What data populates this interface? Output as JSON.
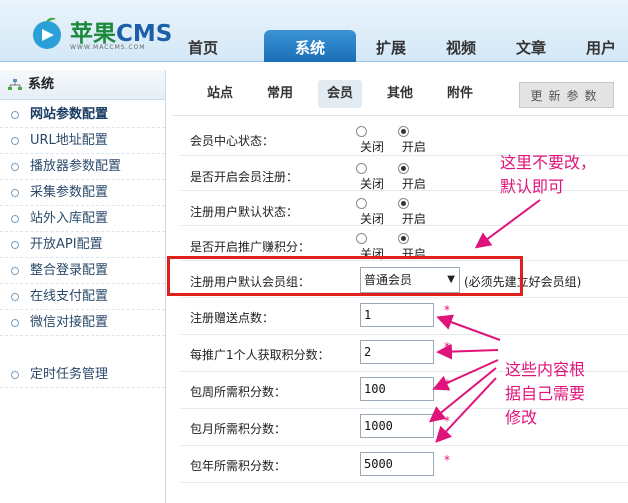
{
  "logo": {
    "brand_main": "苹果",
    "brand_cms": "CMS",
    "site": "WWW.MACCMS.COM"
  },
  "nav": [
    {
      "label": "首页",
      "active": false
    },
    {
      "label": "系统",
      "active": true
    },
    {
      "label": "扩展",
      "active": false
    },
    {
      "label": "视频",
      "active": false
    },
    {
      "label": "文章",
      "active": false
    },
    {
      "label": "用户",
      "active": false
    }
  ],
  "sidebar": {
    "title": "系统",
    "items": [
      {
        "label": "网站参数配置",
        "active": true
      },
      {
        "label": "URL地址配置"
      },
      {
        "label": "播放器参数配置"
      },
      {
        "label": "采集参数配置"
      },
      {
        "label": "站外入库配置"
      },
      {
        "label": "开放API配置"
      },
      {
        "label": "整合登录配置"
      },
      {
        "label": "在线支付配置"
      },
      {
        "label": "微信对接配置"
      },
      {
        "label": "定时任务管理"
      }
    ]
  },
  "tabs": [
    {
      "label": "站点"
    },
    {
      "label": "常用"
    },
    {
      "label": "会员",
      "active": true
    },
    {
      "label": "其他"
    },
    {
      "label": "附件"
    }
  ],
  "update_button": "更新参数",
  "radio_labels": {
    "off": "关闭",
    "on": "开启"
  },
  "rows": {
    "member_center": {
      "label": "会员中心状态：",
      "value": "on"
    },
    "open_register": {
      "label": "是否开启会员注册：",
      "value": "on"
    },
    "register_status": {
      "label": "注册用户默认状态：",
      "value": "on"
    },
    "promo_points": {
      "label": "是否开启推广赚积分：",
      "value": "on"
    },
    "default_group": {
      "label": "注册用户默认会员组：",
      "selected": "普通会员",
      "hint": "(必须先建立好会员组)"
    },
    "reg_points": {
      "label": "注册赠送点数：",
      "value": "1"
    },
    "promo_each": {
      "label": "每推广1个人获取积分数：",
      "value": "2"
    },
    "weekly": {
      "label": "包周所需积分数：",
      "value": "100"
    },
    "monthly": {
      "label": "包月所需积分数：",
      "value": "1000"
    },
    "yearly": {
      "label": "包年所需积分数：",
      "value": "5000"
    }
  },
  "required_mark": "*",
  "annotations": {
    "note1_line1": "这里不要改，",
    "note1_line2": "默认即可",
    "note2_line1": "这些内容根",
    "note2_line2": "据自己需要",
    "note2_line3": "修改"
  },
  "colors": {
    "accent": "#1a6fb6",
    "annotation": "#e0137a",
    "highlight_box": "#e0201b"
  }
}
